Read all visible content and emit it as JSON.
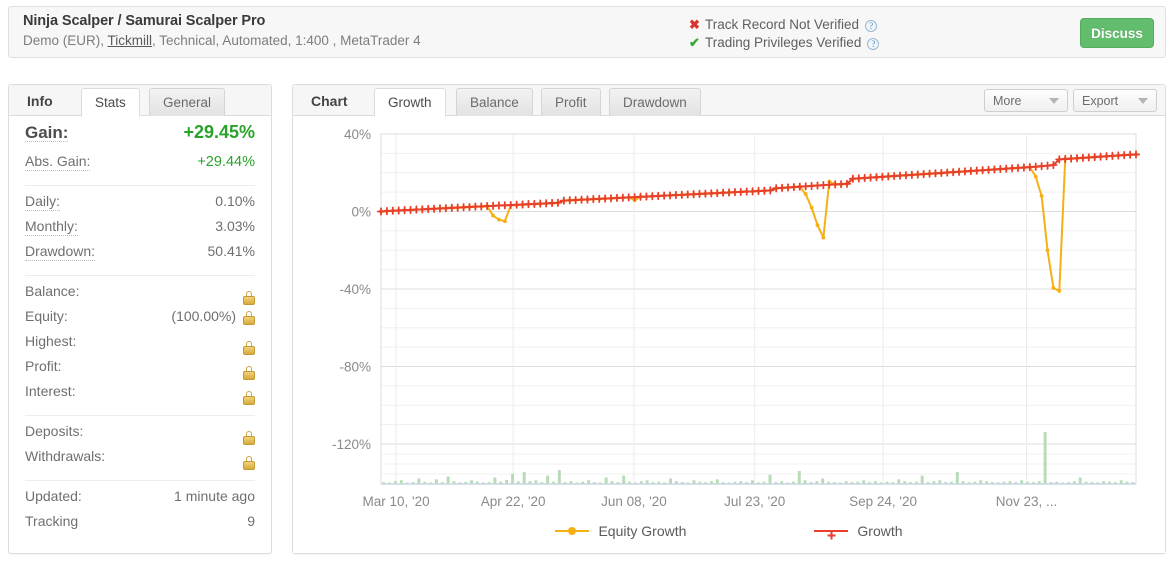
{
  "header": {
    "title": "Ninja Scalper / Samurai Scalper Pro",
    "subtitle_pre": "Demo (EUR), ",
    "broker_link": "Tickmill",
    "subtitle_post": ", Technical, Automated, 1:400 , MetaTrader 4",
    "verification": [
      {
        "icon": "cross-icon",
        "label": "Track Record Not Verified",
        "help": "?"
      },
      {
        "icon": "check-icon",
        "label": "Trading Privileges Verified",
        "help": "?"
      }
    ],
    "discuss_label": "Discuss"
  },
  "left_panel": {
    "tabs": [
      {
        "label": "Info",
        "kind": "static"
      },
      {
        "label": "Stats",
        "kind": "tab",
        "active": true
      },
      {
        "label": "General",
        "kind": "tab",
        "active": false
      }
    ],
    "groups": [
      {
        "rows": [
          {
            "label": "Gain:",
            "value": "+29.45%",
            "style": "big",
            "dotted": true
          },
          {
            "label": "Abs. Gain:",
            "value": "+29.44%",
            "style": "green",
            "dotted": true
          }
        ]
      },
      {
        "rows": [
          {
            "label": "Daily:",
            "value": "0.10%",
            "dotted": true
          },
          {
            "label": "Monthly:",
            "value": "3.03%",
            "dotted": true
          },
          {
            "label": "Drawdown:",
            "value": "50.41%",
            "dotted": true
          }
        ]
      },
      {
        "rows": [
          {
            "label": "Balance:",
            "value": "",
            "lock": true
          },
          {
            "label": "Equity:",
            "value": "(100.00%)",
            "lock": true
          },
          {
            "label": "Highest:",
            "value": "",
            "lock": true
          },
          {
            "label": "Profit:",
            "value": "",
            "lock": true
          },
          {
            "label": "Interest:",
            "value": "",
            "lock": true
          }
        ]
      },
      {
        "rows": [
          {
            "label": "Deposits:",
            "value": "",
            "lock": true
          },
          {
            "label": "Withdrawals:",
            "value": "",
            "lock": true
          }
        ]
      },
      {
        "rows": [
          {
            "label": "Updated:",
            "value": "1 minute ago"
          },
          {
            "label": "Tracking",
            "value": "9"
          }
        ]
      }
    ]
  },
  "right_panel": {
    "tabs": [
      {
        "label": "Chart",
        "kind": "static"
      },
      {
        "label": "Growth",
        "kind": "tab",
        "active": true
      },
      {
        "label": "Balance",
        "kind": "tab",
        "active": false
      },
      {
        "label": "Profit",
        "kind": "tab",
        "active": false
      },
      {
        "label": "Drawdown",
        "kind": "tab",
        "active": false
      }
    ],
    "more_label": "More",
    "export_label": "Export"
  },
  "chart_data": {
    "type": "line",
    "title": "",
    "xlabel": "",
    "ylabel": "",
    "ylim": [
      -120,
      40
    ],
    "yticks": [
      40,
      0,
      -40,
      -80,
      -120
    ],
    "ytick_labels": [
      "40%",
      "0%",
      "-40%",
      "-80%",
      "-120%"
    ],
    "minor_tick_step": 10,
    "grid": true,
    "legend_position": "bottom",
    "xtick_labels": [
      "Mar 10, '20",
      "Apr 22, '20",
      "Jun 08, '20",
      "Jul 23, '20",
      "Sep 24, '20",
      "Nov 23, ..."
    ],
    "xtick_positions": [
      0.02,
      0.175,
      0.335,
      0.495,
      0.665,
      0.855
    ],
    "colors": {
      "growth": "#e8402a",
      "equity_growth": "#f5b016",
      "volume": "#b7dcb5"
    },
    "series": [
      {
        "name": "Growth",
        "color": "#e8402a",
        "marker": "plus",
        "values": [
          0.0,
          0.2,
          0.4,
          0.5,
          0.7,
          0.8,
          1.0,
          1.1,
          1.3,
          1.4,
          1.6,
          1.7,
          1.9,
          2.0,
          2.2,
          2.3,
          2.5,
          2.6,
          2.8,
          2.9,
          3.1,
          3.2,
          3.3,
          3.5,
          3.6,
          3.8,
          3.9,
          4.1,
          4.2,
          4.4,
          4.5,
          5.6,
          5.8,
          5.9,
          6.1,
          6.2,
          6.4,
          6.5,
          6.7,
          6.8,
          7.0,
          7.1,
          7.3,
          7.4,
          7.6,
          7.7,
          7.9,
          8.0,
          8.2,
          8.3,
          8.5,
          8.6,
          8.8,
          8.9,
          9.1,
          9.2,
          9.4,
          9.5,
          9.7,
          9.8,
          10.0,
          10.1,
          10.3,
          10.4,
          10.6,
          10.7,
          10.9,
          12.0,
          12.2,
          12.4,
          12.6,
          12.8,
          13.0,
          13.2,
          13.4,
          13.6,
          13.8,
          14.0,
          14.1,
          14.3,
          16.9,
          17.1,
          17.3,
          17.5,
          17.7,
          17.9,
          18.1,
          18.3,
          18.5,
          18.7,
          18.9,
          19.1,
          19.3,
          19.5,
          19.7,
          19.9,
          20.1,
          20.3,
          20.5,
          20.7,
          20.9,
          21.1,
          21.3,
          21.5,
          21.7,
          21.9,
          22.1,
          22.3,
          22.5,
          22.7,
          22.9,
          23.1,
          23.4,
          23.6,
          24.0,
          26.9,
          27.1,
          27.3,
          27.5,
          27.7,
          27.9,
          28.1,
          28.3,
          28.5,
          28.7,
          28.9,
          29.1,
          29.3,
          29.45
        ]
      },
      {
        "name": "Equity Growth",
        "color": "#f5b016",
        "marker": "circle",
        "values": [
          0.0,
          0.2,
          0.4,
          0.5,
          0.7,
          0.8,
          1.0,
          1.1,
          1.3,
          1.4,
          1.6,
          1.7,
          1.9,
          2.0,
          2.2,
          2.3,
          2.5,
          2.6,
          2.8,
          -2.1,
          -4.2,
          -5.0,
          3.2,
          3.3,
          3.5,
          3.6,
          3.8,
          3.9,
          4.1,
          4.2,
          4.4,
          5.5,
          5.8,
          5.9,
          6.1,
          6.2,
          6.4,
          6.5,
          6.7,
          6.8,
          7.0,
          7.1,
          7.3,
          5.8,
          7.6,
          7.7,
          7.9,
          8.0,
          8.2,
          8.3,
          8.5,
          8.6,
          8.8,
          8.9,
          9.1,
          9.2,
          9.4,
          9.5,
          9.7,
          9.8,
          10.0,
          10.1,
          10.3,
          10.4,
          10.6,
          10.7,
          10.9,
          12.0,
          12.2,
          12.4,
          12.6,
          12.8,
          9.0,
          2.0,
          -7.0,
          -13.5,
          15.5,
          14.0,
          14.1,
          14.3,
          16.9,
          17.1,
          17.3,
          17.5,
          17.7,
          17.9,
          18.1,
          18.3,
          18.5,
          18.7,
          18.9,
          19.1,
          19.3,
          19.5,
          19.7,
          19.9,
          20.1,
          20.3,
          20.5,
          20.7,
          20.9,
          21.1,
          21.3,
          21.5,
          21.7,
          21.9,
          22.1,
          22.3,
          22.5,
          22.7,
          22.9,
          18.0,
          8.0,
          -20.0,
          -39.5,
          -41.0,
          27.1,
          27.3,
          27.5,
          27.7,
          27.9,
          28.1,
          28.3,
          28.5,
          28.7,
          28.9,
          29.1,
          29.3,
          29.45
        ]
      }
    ],
    "volume": {
      "name": "Volume",
      "color": "#b7dcb5",
      "values": [
        1,
        0.5,
        1.5,
        2,
        0.8,
        1,
        3,
        1.2,
        0.6,
        2.5,
        1,
        4,
        1.5,
        0.9,
        1.1,
        2,
        1.3,
        0.7,
        1,
        3.5,
        1.2,
        2.2,
        5.5,
        1.4,
        6.5,
        1.5,
        2,
        1,
        4.5,
        1.2,
        7.5,
        1,
        1.5,
        0.8,
        1.2,
        2,
        1,
        0.6,
        3.5,
        1.5,
        1,
        4.5,
        1.2,
        0.8,
        1.5,
        2,
        1,
        1.2,
        0.9,
        3,
        1.5,
        1,
        0.8,
        2,
        1.2,
        1,
        1.5,
        2.5,
        1,
        0.8,
        1.2,
        1.5,
        1,
        2,
        0.9,
        1.2,
        5,
        1,
        1.5,
        0.8,
        1.2,
        7,
        2,
        1,
        1.5,
        3,
        1.2,
        1,
        0.8,
        1.5,
        1,
        1.2,
        2,
        1,
        1.5,
        0.9,
        1.2,
        1,
        2.5,
        1.5,
        1,
        1.2,
        4.5,
        1,
        1.5,
        2,
        1,
        1.2,
        6.5,
        1.5,
        1,
        1.2,
        2,
        1.5,
        1,
        0.8,
        1.2,
        1.5,
        1,
        2,
        1.2,
        1,
        1.5,
        28,
        1,
        1.2,
        0.8,
        1,
        1.5,
        3.5,
        1.2,
        1,
        0.9,
        1.5,
        1.2,
        1,
        2,
        1.2,
        1
      ]
    },
    "legend": [
      {
        "label": "Equity Growth",
        "color": "#f5b016",
        "marker": "circle"
      },
      {
        "label": "Growth",
        "color": "#e8402a",
        "marker": "plus"
      }
    ]
  }
}
